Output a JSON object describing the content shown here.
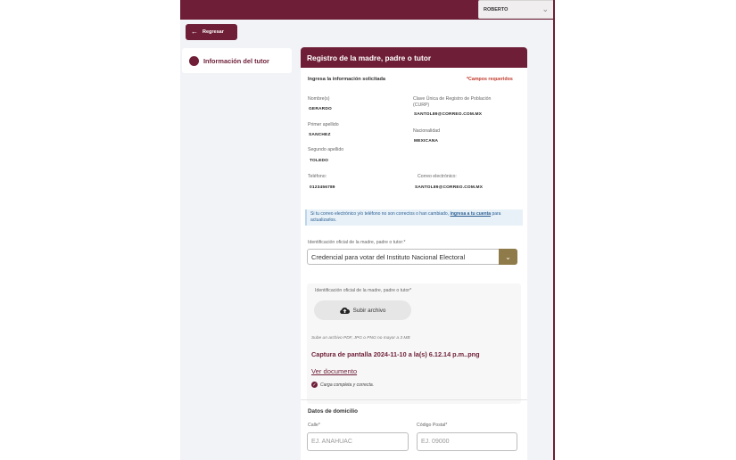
{
  "header": {
    "user_name": "ROBERTO"
  },
  "nav": {
    "back_label": "Regresar",
    "side_item_label": "Información del tutor"
  },
  "form": {
    "title": "Registro de la madre, padre o tutor",
    "instructions": "Ingresa la información solicitada",
    "required_note": "*Campos requeridos",
    "fields": {
      "nombre_label": "Nombre(s)",
      "nombre_value": "GERARDO",
      "primer_apellido_label": "Primer apellido",
      "primer_apellido_value": "SANCHEZ",
      "segundo_apellido_label": "Segundo apellido",
      "segundo_apellido_value": "TOLEDO",
      "telefono_label": "Teléfono:",
      "telefono_value": "0123456789",
      "curp_label_1": "Clave Única de Registro de Población",
      "curp_label_2": "(CURP)",
      "curp_value": "SANTOL89@CORREO.COM.MX",
      "nacionalidad_label": "Nacionalidad",
      "nacionalidad_value": "MEXICANA",
      "correo_label": "Correo electrónico:",
      "correo_value": "SANTOL89@CORREO.COM.MX"
    },
    "notice": {
      "text": "Si tu correo electrónico y/o teléfono no son correctos o han cambiado,",
      "link": "ingresa a tu cuenta",
      "tail": "para actualizarlos."
    },
    "id_select": {
      "label": "Identificación oficial de la madre, padre o tutor:*",
      "value": "Credencial para votar del Instituto Nacional Electoral"
    },
    "upload": {
      "label": "Identificación oficial de la madre, padre o tutor*",
      "button_label": "Subir archivo",
      "hint": "Sube un archivo PDF, JPG o PNG no mayor a 3 MB",
      "file_name": "Captura de pantalla 2024-11-10 a la(s) 6.12.14 p.m..png",
      "view_link": "Ver documento",
      "success_text": "Carga completa y correcta."
    },
    "address": {
      "section_title": "Datos de domicilio",
      "calle_label": "Calle*",
      "calle_placeholder": "EJ. ANÁHUAC",
      "cp_label": "Código Postal*",
      "cp_placeholder": "EJ. 09000"
    }
  },
  "colors": {
    "brand": "#6e1f37",
    "gold": "#8f7a49",
    "arrow": "#d6a417"
  }
}
